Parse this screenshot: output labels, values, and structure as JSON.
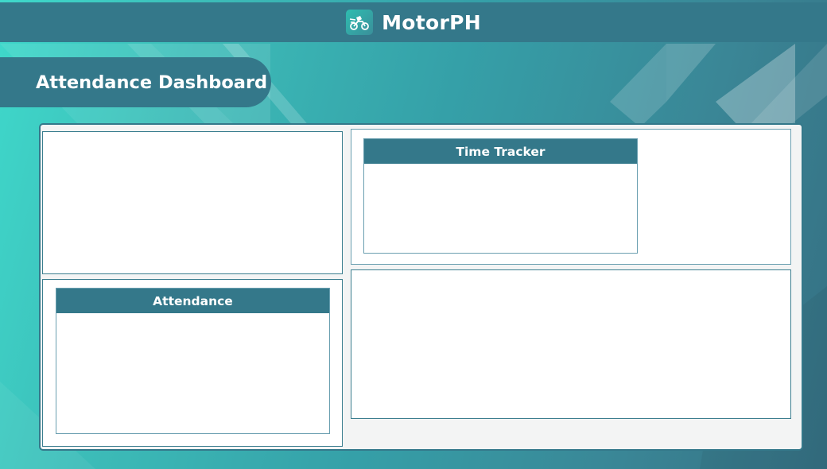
{
  "header": {
    "app_name": "MotorPH",
    "logo_icon": "motorcycle-rider-icon"
  },
  "page": {
    "title": "Attendance Dashboard"
  },
  "panels": {
    "time_tracker": {
      "title": "Time Tracker"
    },
    "attendance": {
      "title": "Attendance"
    }
  },
  "colors": {
    "primary": "#34788a",
    "panel_background": "#f3f4f4",
    "card_background": "#ffffff",
    "background_gradient_start": "#3fd9cb",
    "background_gradient_end": "#356f82"
  }
}
